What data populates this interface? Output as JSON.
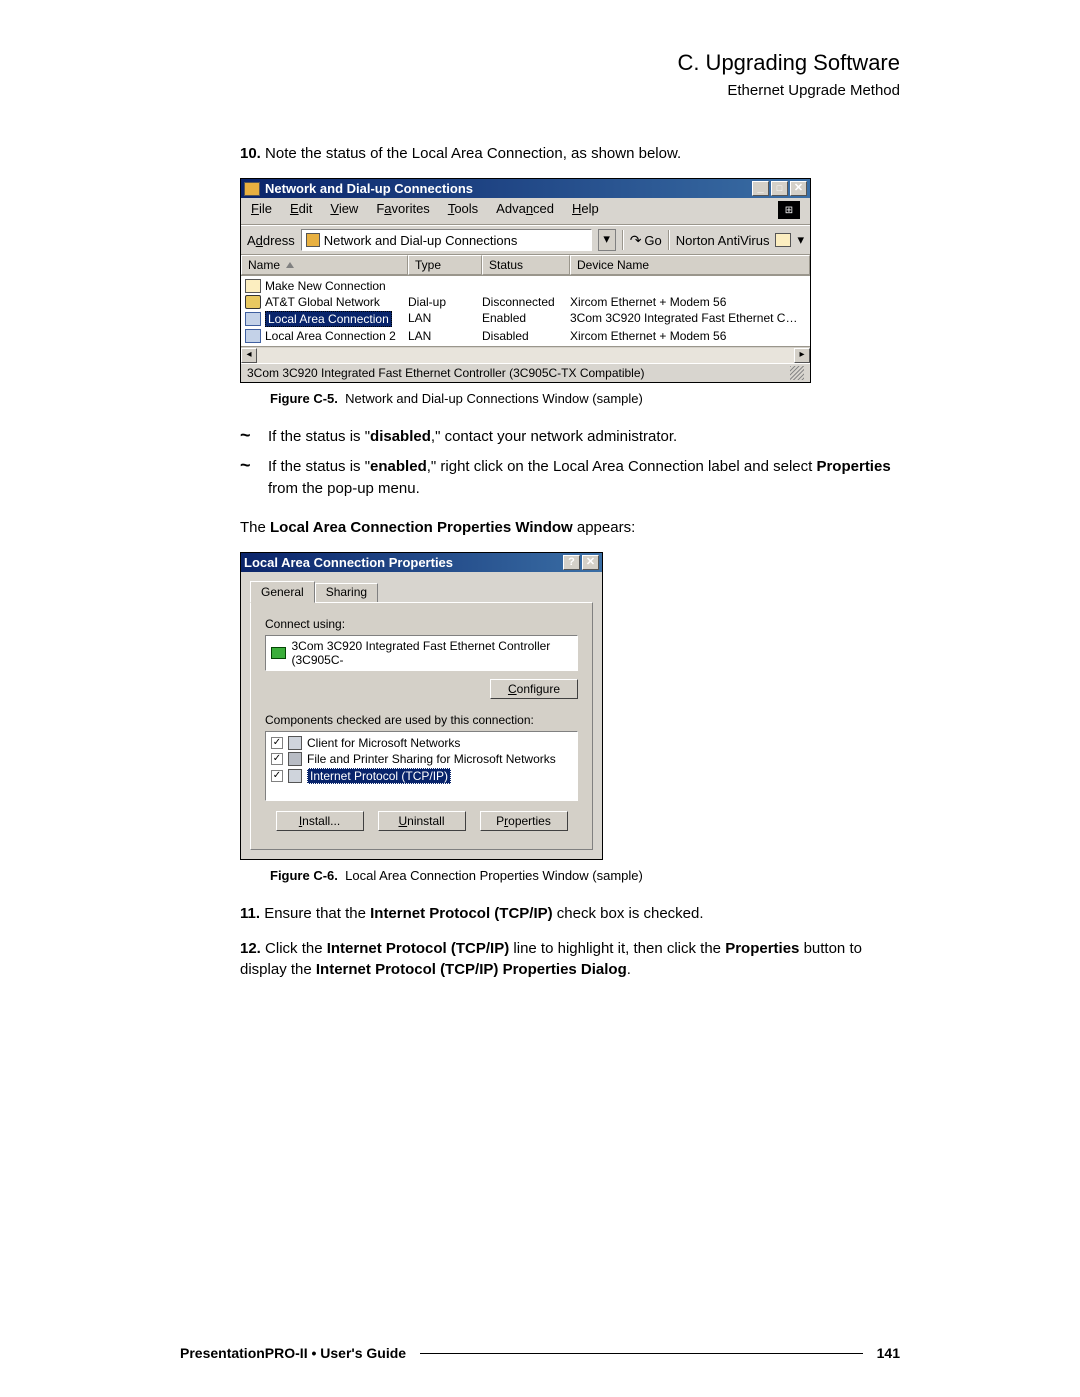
{
  "page": {
    "title": "C. Upgrading Software",
    "subtitle": "Ethernet Upgrade Method"
  },
  "steps": {
    "s10": {
      "num": "10.",
      "text": "Note the status of the Local Area Connection, as shown below."
    },
    "s11": {
      "num": "11.",
      "p1": "Ensure that the ",
      "b1": "Internet Protocol (TCP/IP)",
      "p2": " check box is checked."
    },
    "s12": {
      "num": "12.",
      "p1": "Click the ",
      "b1": "Internet Protocol (TCP/IP)",
      "p2": " line to highlight it, then click the ",
      "b2": "Properties",
      "p3": " button to display the ",
      "b3": "Internet Protocol (TCP/IP) Properties Dialog",
      "p4": "."
    }
  },
  "bullets": {
    "b1": {
      "p1": "If the status is \"",
      "bold": "disabled",
      "p2": ",\" contact your network administrator."
    },
    "b2": {
      "p1": "If the status is \"",
      "bold": "enabled",
      "p2": ",\" right click on the Local Area Connection label and select ",
      "bold2": "Properties",
      "p3": " from the pop-up menu."
    }
  },
  "para1": {
    "p1": "The ",
    "b1": "Local Area Connection Properties Window",
    "p2": " appears:"
  },
  "fig5": {
    "label": "Figure C-5.",
    "caption": "Network and Dial-up Connections Window  (sample)"
  },
  "fig6": {
    "label": "Figure C-6.",
    "caption": "Local Area Connection Properties Window  (sample)"
  },
  "win1": {
    "title": "Network and Dial-up Connections",
    "menu": {
      "file": "File",
      "edit": "Edit",
      "view": "View",
      "fav": "Favorites",
      "tools": "Tools",
      "adv": "Advanced",
      "help": "Help"
    },
    "toolbar": {
      "addr_lbl": "Address",
      "addr_val": "Network and Dial-up Connections",
      "go": "Go",
      "norton": "Norton AntiVirus"
    },
    "headers": {
      "name": "Name",
      "type": "Type",
      "status": "Status",
      "device": "Device Name"
    },
    "rows": [
      {
        "name": "Make New Connection",
        "type": "",
        "status": "",
        "device": ""
      },
      {
        "name": "AT&T Global Network",
        "type": "Dial-up",
        "status": "Disconnected",
        "device": "Xircom Ethernet + Modem 56"
      },
      {
        "name": "Local Area Connection",
        "type": "LAN",
        "status": "Enabled",
        "device": "3Com 3C920 Integrated Fast Ethernet C…"
      },
      {
        "name": "Local Area Connection 2",
        "type": "LAN",
        "status": "Disabled",
        "device": "Xircom Ethernet + Modem 56"
      }
    ],
    "status": "3Com 3C920 Integrated Fast Ethernet Controller (3C905C-TX Compatible)"
  },
  "win2": {
    "title": "Local Area Connection Properties",
    "tabs": {
      "general": "General",
      "sharing": "Sharing"
    },
    "connect_using_lbl": "Connect using:",
    "adapter": "3Com 3C920 Integrated Fast Ethernet Controller (3C905C-",
    "configure": "Configure",
    "components_lbl": "Components checked are used by this connection:",
    "components": [
      "Client for Microsoft Networks",
      "File and Printer Sharing for Microsoft Networks",
      "Internet Protocol (TCP/IP)"
    ],
    "buttons": {
      "install": "Install...",
      "uninstall": "Uninstall",
      "properties": "Properties"
    }
  },
  "footer": {
    "doc": "PresentationPRO-II  •  User's Guide",
    "page": "141"
  }
}
